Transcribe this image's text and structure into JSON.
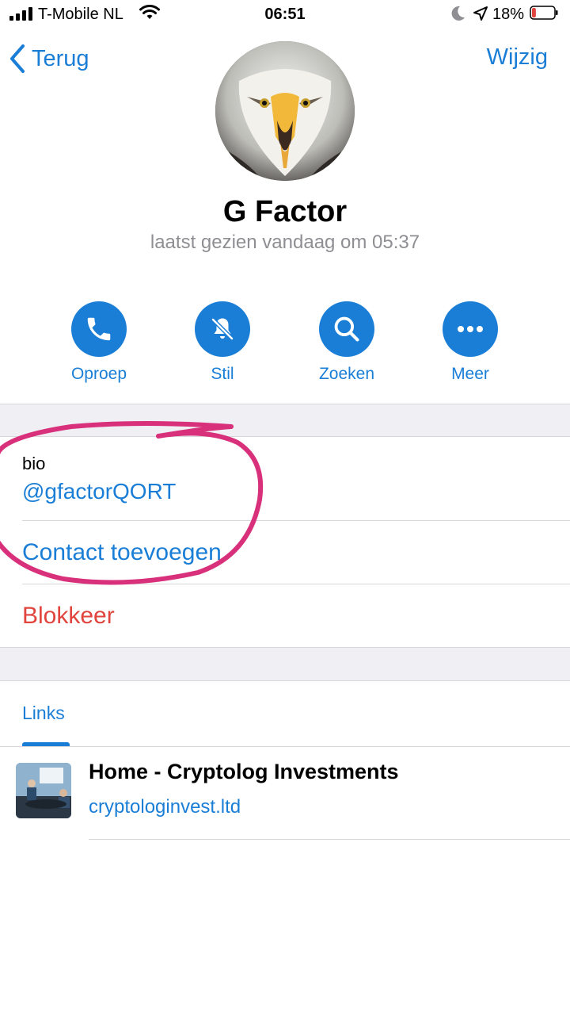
{
  "status_bar": {
    "carrier": "T-Mobile NL",
    "time": "06:51",
    "battery_percent": "18%",
    "battery_level": 0.18,
    "icons": [
      "signal-icon",
      "wifi-icon",
      "moon-icon",
      "location-icon",
      "battery-icon"
    ]
  },
  "nav": {
    "back_label": "Terug",
    "edit_label": "Wijzig"
  },
  "profile": {
    "name": "G Factor",
    "last_seen": "laatst gezien vandaag om 05:37"
  },
  "actions": [
    {
      "label": "Oproep",
      "icon": "phone-icon"
    },
    {
      "label": "Stil",
      "icon": "bell-slash-icon"
    },
    {
      "label": "Zoeken",
      "icon": "search-icon"
    },
    {
      "label": "Meer",
      "icon": "more-icon"
    }
  ],
  "bio": {
    "label": "bio",
    "value": "@gfactorQORT"
  },
  "rows": {
    "add_contact": "Contact toevoegen",
    "block": "Blokkeer"
  },
  "media": {
    "tab": "Links",
    "link": {
      "title": "Home - Cryptolog Investments",
      "url": "cryptologinvest.ltd"
    }
  },
  "colors": {
    "accent": "#1a7ed7",
    "destructive": "#e0443c",
    "annotation": "#d8307a",
    "separator": "#efeff4"
  }
}
